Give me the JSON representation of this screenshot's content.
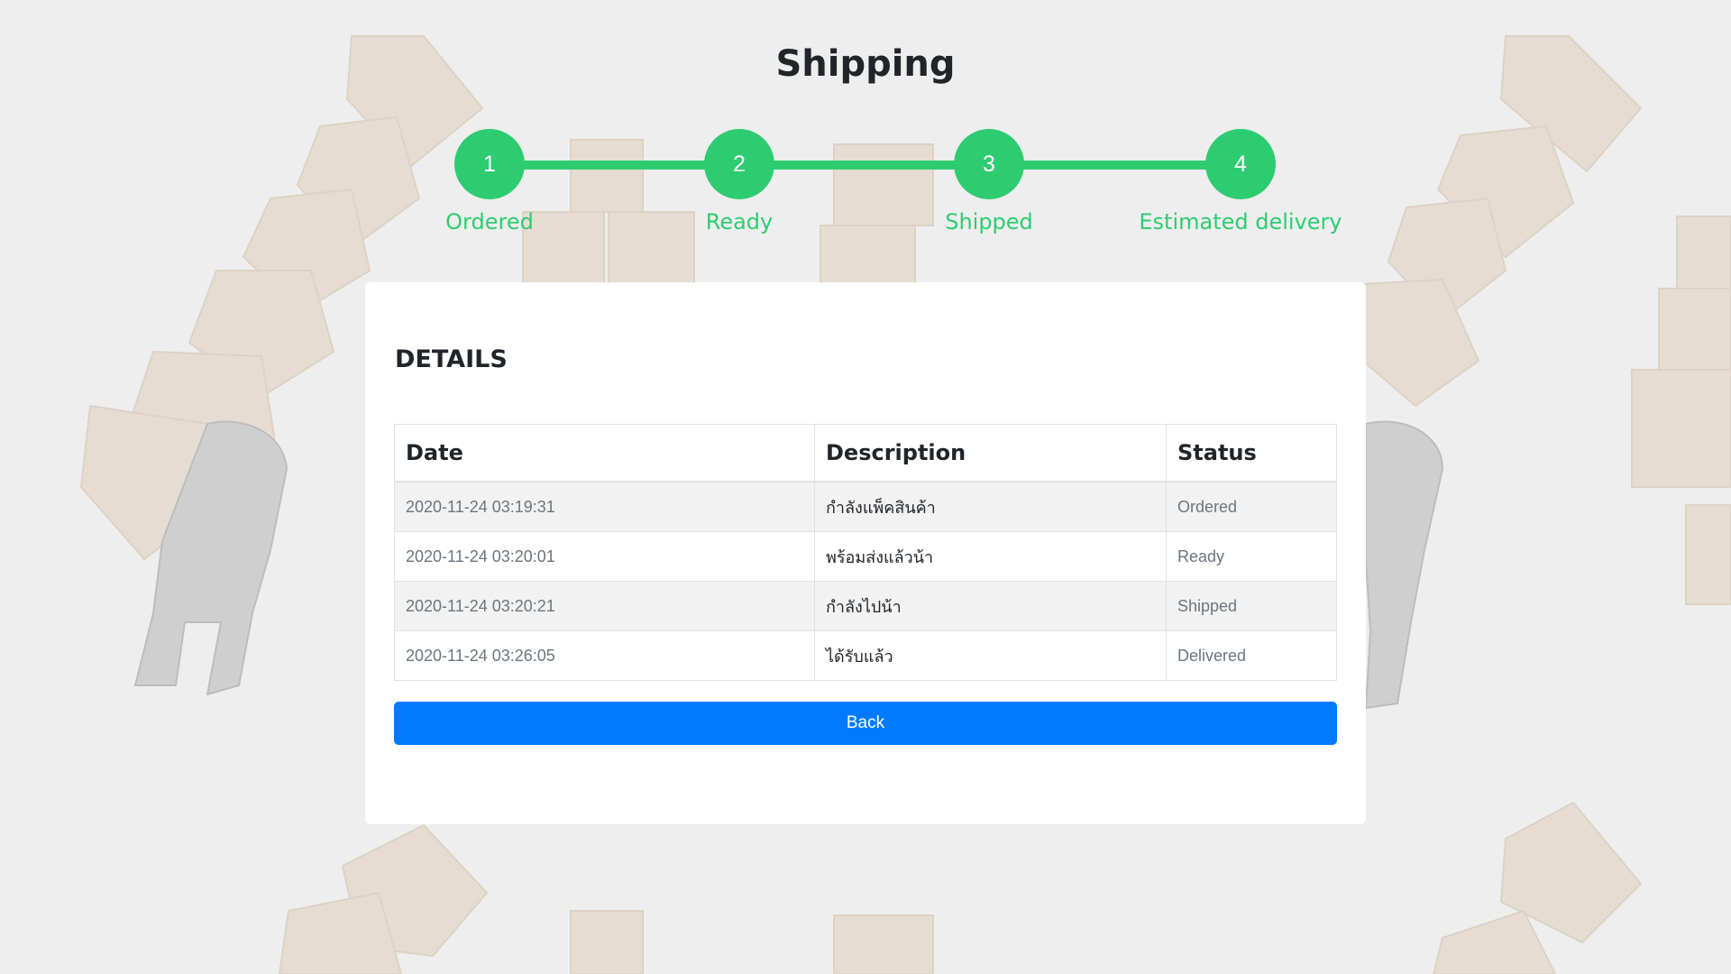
{
  "page": {
    "title": "Shipping"
  },
  "tracker": {
    "color": "#2ecc71",
    "steps": [
      {
        "number": "1",
        "label": "Ordered"
      },
      {
        "number": "2",
        "label": "Ready"
      },
      {
        "number": "3",
        "label": "Shipped"
      },
      {
        "number": "4",
        "label": "Estimated delivery"
      }
    ]
  },
  "details": {
    "heading": "DETAILS",
    "columns": [
      "Date",
      "Description",
      "Status"
    ],
    "rows": [
      {
        "date": "2020-11-24 03:19:31",
        "description": "กำลังแพ็คสินค้า",
        "status": "Ordered"
      },
      {
        "date": "2020-11-24 03:20:01",
        "description": "พร้อมส่งแล้วน้า",
        "status": "Ready"
      },
      {
        "date": "2020-11-24 03:20:21",
        "description": "กำลังไปน้า",
        "status": "Shipped"
      },
      {
        "date": "2020-11-24 03:26:05",
        "description": "ได้รับแล้ว",
        "status": "Delivered"
      }
    ],
    "back_label": "Back",
    "back_color": "#007bff"
  }
}
